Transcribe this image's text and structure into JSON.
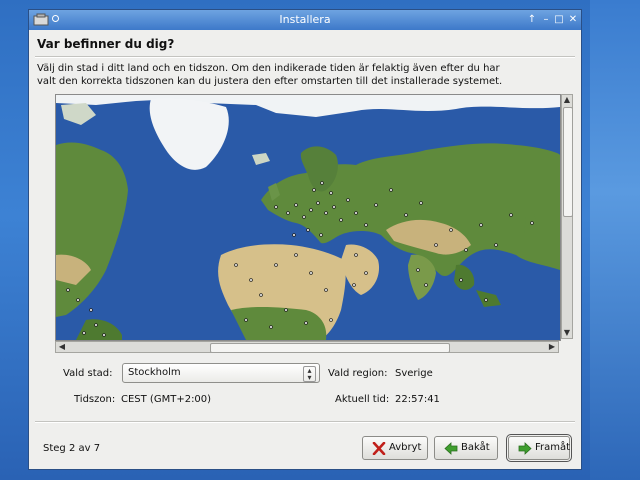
{
  "window": {
    "title": "Installera"
  },
  "page": {
    "heading": "Var befinner du dig?",
    "intro_line1": "Välj din stad i ditt land och en tidszon. Om den indikerade tiden är felaktig även efter du har",
    "intro_line2": "valt den korrekta tidszonen kan du justera den efter omstarten till det installerade systemet."
  },
  "form": {
    "city_label": "Vald stad:",
    "city_value": "Stockholm",
    "region_label": "Vald region:",
    "region_value": "Sverige",
    "tz_label": "Tidszon:",
    "tz_value": "CEST (GMT+2:00)",
    "time_label": "Aktuell tid:",
    "time_value": "22:57:41"
  },
  "footer": {
    "step": "Steg 2 av 7",
    "cancel_label": "Avbryt",
    "back_label": "Bakåt",
    "forward_label": "Framåt"
  },
  "colors": {
    "ocean": "#2a5aa8",
    "land_green": "#5f8a3c",
    "desert": "#d6c08a",
    "ice": "#f2f4f6",
    "titlebar": "#4a86d0"
  },
  "icons": {
    "cancel": "x-icon",
    "back": "arrow-left-icon",
    "forward": "arrow-right-icon"
  }
}
